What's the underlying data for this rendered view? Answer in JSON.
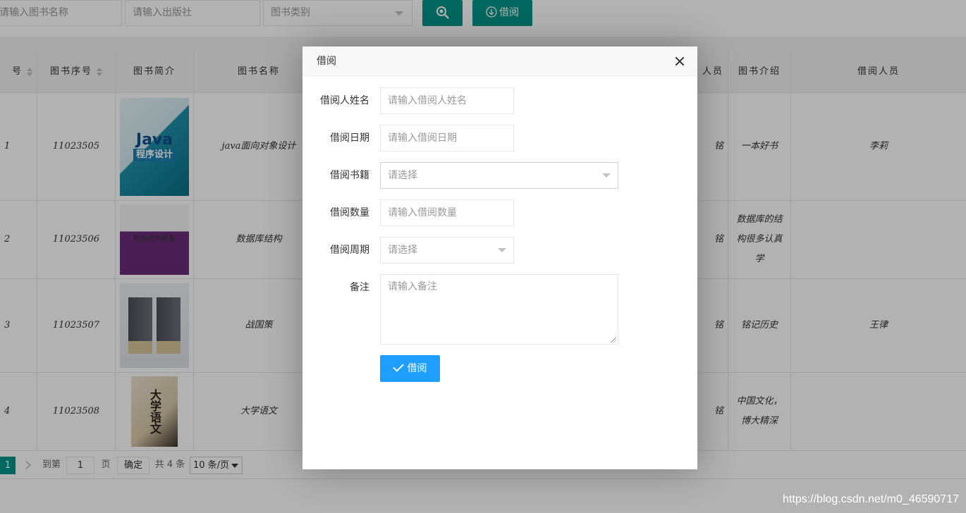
{
  "toolbar": {
    "book_name_placeholder": "请输入图书名称",
    "publisher_placeholder": "请输入出版社",
    "category_placeholder": "图书类别",
    "search_icon": "search-icon",
    "borrow_label": "借阅",
    "borrow_icon": "download-circle-icon"
  },
  "table": {
    "headers": [
      "号",
      "图书序号",
      "图书简介",
      "图书名称",
      "人员",
      "图书介绍",
      "借阅人员"
    ],
    "rows": [
      {
        "id": "1",
        "serial": "11023505",
        "cover_title": "Java",
        "cover_subtitle": "程序设计",
        "name": "java面向对象设计",
        "person": "铭",
        "intro": "一本好书",
        "borrower": "李莉"
      },
      {
        "id": "2",
        "serial": "11023506",
        "cover_title": "数据结构题集",
        "cover_subtitle": "",
        "name": "数据库结构",
        "person": "铭",
        "intro": "数据库的结构很多认真学",
        "borrower": ""
      },
      {
        "id": "3",
        "serial": "11023507",
        "cover_title": "",
        "cover_subtitle": "",
        "name": "战国策",
        "person": "铭",
        "intro": "铭记历史",
        "borrower": "王律"
      },
      {
        "id": "4",
        "serial": "11023508",
        "cover_title": "大学语文",
        "cover_subtitle": "",
        "name": "大学语文",
        "person": "铭",
        "intro": "中国文化，博大精深",
        "borrower": ""
      }
    ]
  },
  "pager": {
    "current_page": "1",
    "goto_label": "到第",
    "page_value": "1",
    "page_unit": "页",
    "confirm_label": "确定",
    "total_label": "共 4 条",
    "page_size": "10 条/页"
  },
  "modal": {
    "title": "借阅",
    "fields": {
      "borrower_name_label": "借阅人姓名",
      "borrower_name_placeholder": "请输入借阅人姓名",
      "borrow_date_label": "借阅日期",
      "borrow_date_placeholder": "请输入借阅日期",
      "book_label": "借阅书籍",
      "book_placeholder": "请选择",
      "quantity_label": "借阅数量",
      "quantity_placeholder": "请输入借阅数量",
      "period_label": "借阅周期",
      "period_placeholder": "请选择",
      "remark_label": "备注",
      "remark_placeholder": "请输入备注"
    },
    "submit_label": "借阅"
  },
  "watermark": "https://blog.csdn.net/m0_46590717",
  "colors": {
    "primary": "#009688",
    "accent": "#1e9fff"
  }
}
